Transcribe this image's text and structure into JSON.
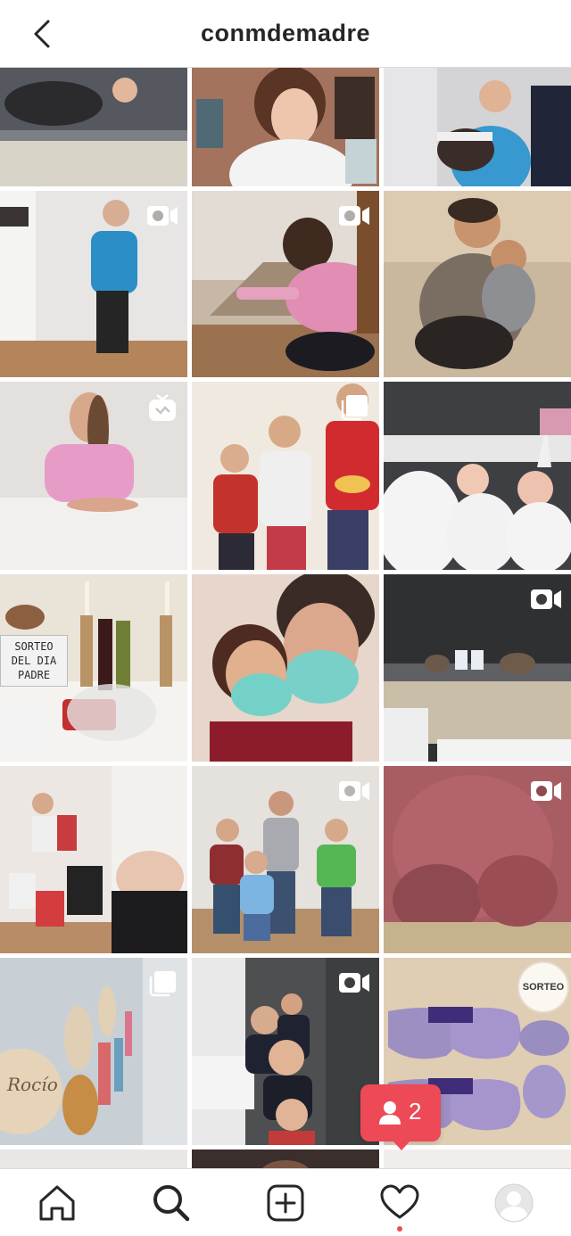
{
  "header": {
    "username": "conmdemadre",
    "back_icon": "chevron-left-icon"
  },
  "grid": {
    "tiles": [
      {
        "row": 0,
        "col": 0,
        "type": "photo",
        "color": "#8b9096"
      },
      {
        "row": 0,
        "col": 1,
        "type": "photo",
        "color": "#c89a86"
      },
      {
        "row": 0,
        "col": 2,
        "type": "photo",
        "color": "#a7b2c1"
      },
      {
        "row": 1,
        "col": 0,
        "type": "video",
        "color": "#cfc8c0"
      },
      {
        "row": 1,
        "col": 1,
        "type": "video",
        "color": "#b9a596"
      },
      {
        "row": 1,
        "col": 2,
        "type": "photo",
        "color": "#9c8e7a"
      },
      {
        "row": 2,
        "col": 0,
        "type": "igtv",
        "color": "#d9d4d1"
      },
      {
        "row": 2,
        "col": 1,
        "type": "carousel",
        "color": "#d6c9b7"
      },
      {
        "row": 2,
        "col": 2,
        "type": "photo",
        "color": "#6f7277"
      },
      {
        "row": 3,
        "col": 0,
        "type": "photo",
        "color": "#b9ad9f"
      },
      {
        "row": 3,
        "col": 1,
        "type": "photo",
        "color": "#8c6f64"
      },
      {
        "row": 3,
        "col": 2,
        "type": "video",
        "color": "#4a4b4d"
      },
      {
        "row": 4,
        "col": 0,
        "type": "photo",
        "color": "#d0c3b4"
      },
      {
        "row": 4,
        "col": 1,
        "type": "video",
        "color": "#c5c0b9"
      },
      {
        "row": 4,
        "col": 2,
        "type": "video",
        "color": "#8b4f52"
      },
      {
        "row": 5,
        "col": 0,
        "type": "carousel",
        "color": "#b6bfc6"
      },
      {
        "row": 5,
        "col": 1,
        "type": "video",
        "color": "#7d7b79"
      },
      {
        "row": 5,
        "col": 2,
        "type": "photo",
        "color": "#d8c8b3"
      }
    ],
    "sorteo_post_1": {
      "line1": "SORTEO",
      "line2": "DEL DIA",
      "line3": "PADRE"
    },
    "sorteo_post_2": "SORTEO",
    "name_tag_text": "Rocío"
  },
  "notification": {
    "count": "2",
    "icon": "user-icon"
  },
  "tabbar": {
    "home": "home-icon",
    "search": "search-icon",
    "new_post": "plus-square-icon",
    "activity": "heart-icon",
    "profile": "avatar"
  },
  "colors": {
    "accent": "#ed4956",
    "text": "#262626",
    "divider": "#dbdbdb"
  }
}
